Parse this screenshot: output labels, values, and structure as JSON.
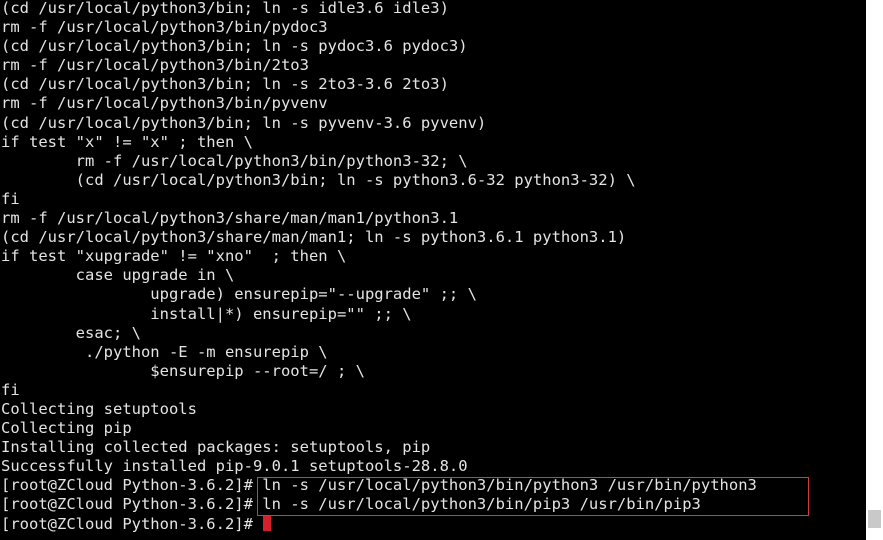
{
  "terminal": {
    "lines": [
      "(cd /usr/local/python3/bin; ln -s idle3.6 idle3)",
      "rm -f /usr/local/python3/bin/pydoc3",
      "(cd /usr/local/python3/bin; ln -s pydoc3.6 pydoc3)",
      "rm -f /usr/local/python3/bin/2to3",
      "(cd /usr/local/python3/bin; ln -s 2to3-3.6 2to3)",
      "rm -f /usr/local/python3/bin/pyvenv",
      "(cd /usr/local/python3/bin; ln -s pyvenv-3.6 pyvenv)",
      "if test \"x\" != \"x\" ; then \\",
      "        rm -f /usr/local/python3/bin/python3-32; \\",
      "        (cd /usr/local/python3/bin; ln -s python3.6-32 python3-32) \\",
      "fi",
      "rm -f /usr/local/python3/share/man/man1/python3.1",
      "(cd /usr/local/python3/share/man/man1; ln -s python3.6.1 python3.1)",
      "if test \"xupgrade\" != \"xno\"  ; then \\",
      "        case upgrade in \\",
      "                upgrade) ensurepip=\"--upgrade\" ;; \\",
      "                install|*) ensurepip=\"\" ;; \\",
      "        esac; \\",
      "         ./python -E -m ensurepip \\",
      "                $ensurepip --root=/ ; \\",
      "fi",
      "Collecting setuptools",
      "Collecting pip",
      "Installing collected packages: setuptools, pip",
      "Successfully installed pip-9.0.1 setuptools-28.8.0",
      "[root@ZCloud Python-3.6.2]# ln -s /usr/local/python3/bin/python3 /usr/bin/python3",
      "[root@ZCloud Python-3.6.2]# ln -s /usr/local/python3/bin/pip3 /usr/bin/pip3",
      "[root@ZCloud Python-3.6.2]# "
    ]
  },
  "colors": {
    "background": "#000000",
    "foreground": "#e4e4e4",
    "cursor": "#d4202a",
    "highlight_border": "#d83a3a"
  }
}
